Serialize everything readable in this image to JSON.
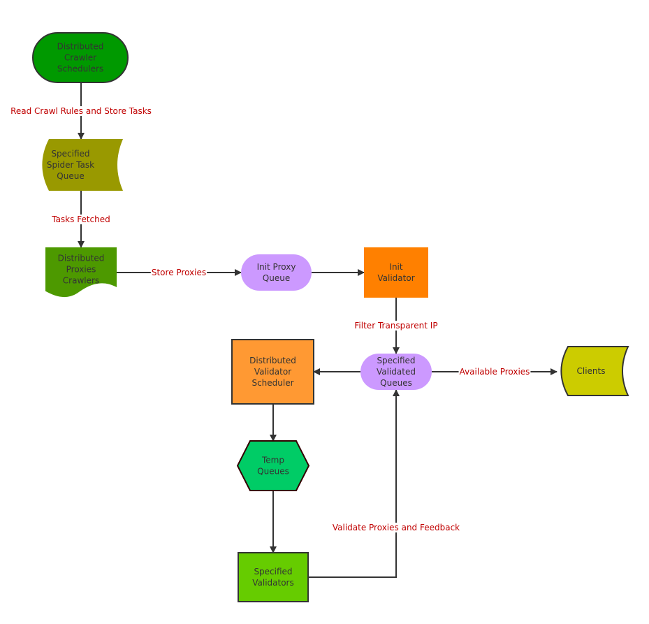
{
  "diagram": {
    "type": "flowchart",
    "label_color": "#c00000",
    "line_color": "#333333",
    "nodes": [
      {
        "id": "crawler_schedulers",
        "shape": "terminator",
        "fill": "#009900",
        "border": "#333333",
        "lines": [
          "Distributed",
          "Crawler",
          "Schedulers"
        ]
      },
      {
        "id": "spider_task_queue",
        "shape": "stored-data",
        "fill": "#999900",
        "border": "none",
        "lines": [
          "Specified",
          "Spider Task",
          "Queue"
        ]
      },
      {
        "id": "proxies_crawlers",
        "shape": "document",
        "fill": "#4d9900",
        "border": "none",
        "lines": [
          "Distributed",
          "Proxies",
          "Crawlers"
        ]
      },
      {
        "id": "init_proxy_queue",
        "shape": "terminator",
        "fill": "#cc99ff",
        "border": "none",
        "lines": [
          "Init Proxy",
          "Queue"
        ]
      },
      {
        "id": "init_validator",
        "shape": "process",
        "fill": "#ff8000",
        "border": "none",
        "lines": [
          "Init",
          "Validator"
        ]
      },
      {
        "id": "validated_queues",
        "shape": "terminator",
        "fill": "#cc99ff",
        "border": "none",
        "lines": [
          "Specified",
          "Validated",
          "Queues"
        ]
      },
      {
        "id": "validator_scheduler",
        "shape": "process",
        "fill": "#ff9933",
        "border": "#333333",
        "lines": [
          "Distributed",
          "Validator",
          "Scheduler"
        ]
      },
      {
        "id": "clients",
        "shape": "stored-data",
        "fill": "#cccc00",
        "border": "#333333",
        "lines": [
          "Clients"
        ]
      },
      {
        "id": "temp_queues",
        "shape": "hexagon",
        "fill": "#00cc66",
        "border": "#330000",
        "lines": [
          "Temp",
          "Queues"
        ]
      },
      {
        "id": "specified_validators",
        "shape": "process",
        "fill": "#66cc00",
        "border": "#333333",
        "lines": [
          "Specified",
          "Validators"
        ]
      }
    ],
    "edges": [
      {
        "from": "crawler_schedulers",
        "to": "spider_task_queue",
        "label": "Read Crawl Rules and Store Tasks"
      },
      {
        "from": "spider_task_queue",
        "to": "proxies_crawlers",
        "label": "Tasks Fetched"
      },
      {
        "from": "proxies_crawlers",
        "to": "init_proxy_queue",
        "label": "Store Proxies"
      },
      {
        "from": "init_proxy_queue",
        "to": "init_validator",
        "label": ""
      },
      {
        "from": "init_validator",
        "to": "validated_queues",
        "label": "Filter Transparent IP"
      },
      {
        "from": "validated_queues",
        "to": "validator_scheduler",
        "label": ""
      },
      {
        "from": "validated_queues",
        "to": "clients",
        "label": "Available Proxies"
      },
      {
        "from": "validator_scheduler",
        "to": "temp_queues",
        "label": ""
      },
      {
        "from": "temp_queues",
        "to": "specified_validators",
        "label": ""
      },
      {
        "from": "specified_validators",
        "to": "validated_queues",
        "label": "Validate Proxies and Feedback"
      }
    ]
  }
}
